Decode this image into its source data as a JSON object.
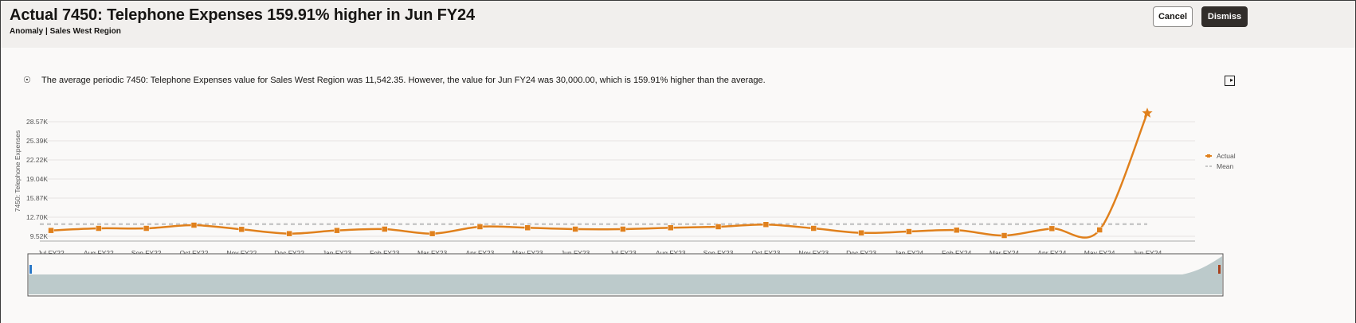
{
  "header": {
    "title": "Actual 7450: Telephone Expenses 159.91% higher in Jun FY24",
    "subtitle": "Anomaly | Sales West Region",
    "cancel_label": "Cancel",
    "dismiss_label": "Dismiss"
  },
  "message": "The average periodic 7450: Telephone Expenses value for Sales West Region was 11,542.35. However, the value for Jun FY24 was 30,000.00, which is 159.91% higher than the average.",
  "icons": {
    "info": "insight-icon",
    "panel": "panel-toggle-icon"
  },
  "colors": {
    "actual": "#e0801c",
    "mean": "#c8c8c8",
    "header_bg": "#f1efed",
    "dismiss_bg": "#312d2a"
  },
  "chart_data": {
    "type": "line",
    "ylabel": "7450: Telephone Expenses",
    "yticks": [
      "9.52K",
      "12.70K",
      "15.87K",
      "19.04K",
      "22.22K",
      "25.39K",
      "28.57K"
    ],
    "ytick_values": [
      9520,
      12700,
      15870,
      19040,
      22220,
      25390,
      28570
    ],
    "categories": [
      "Jul FY22",
      "Aug FY22",
      "Sep FY22",
      "Oct FY22",
      "Nov FY22",
      "Dec FY22",
      "Jan FY23",
      "Feb FY23",
      "Mar FY23",
      "Apr FY23",
      "May FY23",
      "Jun FY23",
      "Jul FY23",
      "Aug FY23",
      "Sep FY23",
      "Oct FY23",
      "Nov FY23",
      "Dec FY23",
      "Jan FY24",
      "Feb FY24",
      "Mar FY24",
      "Apr FY24",
      "May FY24",
      "Jun FY24"
    ],
    "series": [
      {
        "name": "Actual",
        "values": [
          10490,
          10840,
          10840,
          11370,
          10670,
          9960,
          10490,
          10710,
          9960,
          11110,
          10940,
          10710,
          10710,
          10940,
          11110,
          11470,
          10840,
          10090,
          10310,
          10540,
          9650,
          10800,
          10580,
          30000
        ]
      },
      {
        "name": "Mean",
        "values": [
          11542.35
        ]
      }
    ],
    "ylim": [
      8560,
      30000
    ],
    "grid": true,
    "legend": "right",
    "anomaly_marker": "star"
  }
}
